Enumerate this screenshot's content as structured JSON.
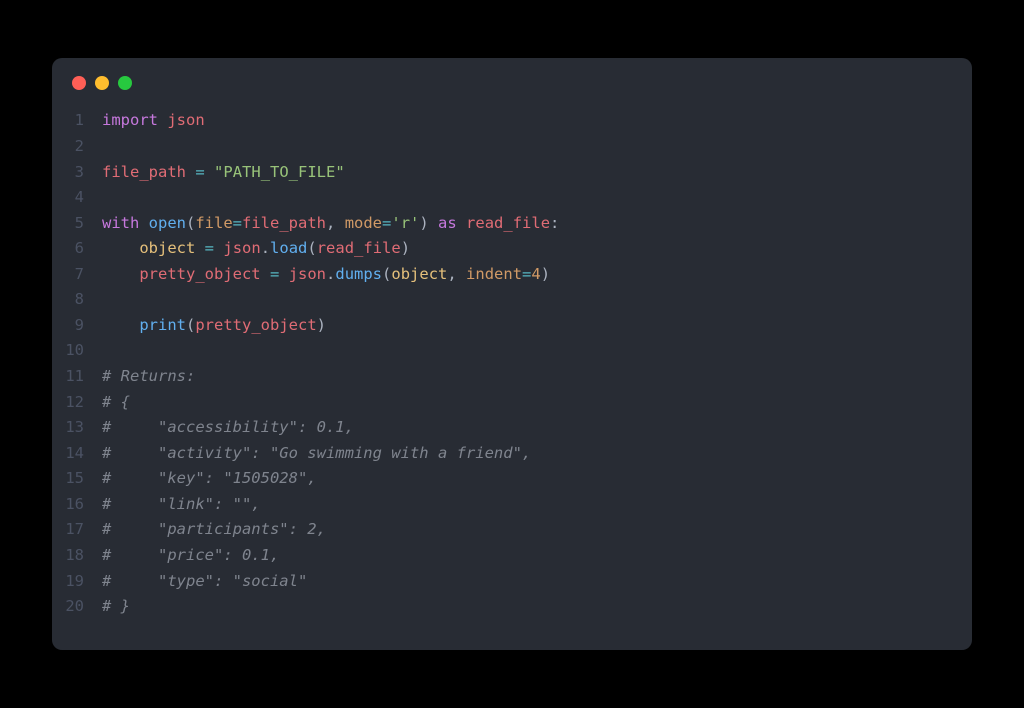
{
  "window": {
    "traffic_lights": [
      "close",
      "minimize",
      "zoom"
    ]
  },
  "editor": {
    "language": "python",
    "lines": [
      {
        "num": 1,
        "tokens": [
          {
            "t": "kw",
            "s": "import"
          },
          {
            "t": "pn",
            "s": " "
          },
          {
            "t": "var",
            "s": "json"
          }
        ]
      },
      {
        "num": 2,
        "tokens": []
      },
      {
        "num": 3,
        "tokens": [
          {
            "t": "var",
            "s": "file_path"
          },
          {
            "t": "pn",
            "s": " "
          },
          {
            "t": "op",
            "s": "="
          },
          {
            "t": "pn",
            "s": " "
          },
          {
            "t": "str",
            "s": "\"PATH_TO_FILE\""
          }
        ]
      },
      {
        "num": 4,
        "tokens": []
      },
      {
        "num": 5,
        "tokens": [
          {
            "t": "kw",
            "s": "with"
          },
          {
            "t": "pn",
            "s": " "
          },
          {
            "t": "fn",
            "s": "open"
          },
          {
            "t": "pn",
            "s": "("
          },
          {
            "t": "param",
            "s": "file"
          },
          {
            "t": "op",
            "s": "="
          },
          {
            "t": "var",
            "s": "file_path"
          },
          {
            "t": "pn",
            "s": ", "
          },
          {
            "t": "param",
            "s": "mode"
          },
          {
            "t": "op",
            "s": "="
          },
          {
            "t": "str",
            "s": "'r'"
          },
          {
            "t": "pn",
            "s": ") "
          },
          {
            "t": "kw",
            "s": "as"
          },
          {
            "t": "pn",
            "s": " "
          },
          {
            "t": "var",
            "s": "read_file"
          },
          {
            "t": "pn",
            "s": ":"
          }
        ]
      },
      {
        "num": 6,
        "tokens": [
          {
            "t": "pn",
            "s": "    "
          },
          {
            "t": "ident",
            "s": "object"
          },
          {
            "t": "pn",
            "s": " "
          },
          {
            "t": "op",
            "s": "="
          },
          {
            "t": "pn",
            "s": " "
          },
          {
            "t": "var",
            "s": "json"
          },
          {
            "t": "pn",
            "s": "."
          },
          {
            "t": "fn",
            "s": "load"
          },
          {
            "t": "pn",
            "s": "("
          },
          {
            "t": "var",
            "s": "read_file"
          },
          {
            "t": "pn",
            "s": ")"
          }
        ]
      },
      {
        "num": 7,
        "tokens": [
          {
            "t": "pn",
            "s": "    "
          },
          {
            "t": "var",
            "s": "pretty_object"
          },
          {
            "t": "pn",
            "s": " "
          },
          {
            "t": "op",
            "s": "="
          },
          {
            "t": "pn",
            "s": " "
          },
          {
            "t": "var",
            "s": "json"
          },
          {
            "t": "pn",
            "s": "."
          },
          {
            "t": "fn",
            "s": "dumps"
          },
          {
            "t": "pn",
            "s": "("
          },
          {
            "t": "ident",
            "s": "object"
          },
          {
            "t": "pn",
            "s": ", "
          },
          {
            "t": "param",
            "s": "indent"
          },
          {
            "t": "op",
            "s": "="
          },
          {
            "t": "num",
            "s": "4"
          },
          {
            "t": "pn",
            "s": ")"
          }
        ]
      },
      {
        "num": 8,
        "tokens": []
      },
      {
        "num": 9,
        "tokens": [
          {
            "t": "pn",
            "s": "    "
          },
          {
            "t": "fn",
            "s": "print"
          },
          {
            "t": "pn",
            "s": "("
          },
          {
            "t": "var",
            "s": "pretty_object"
          },
          {
            "t": "pn",
            "s": ")"
          }
        ]
      },
      {
        "num": 10,
        "tokens": []
      },
      {
        "num": 11,
        "tokens": [
          {
            "t": "cmt",
            "s": "# Returns:"
          }
        ]
      },
      {
        "num": 12,
        "tokens": [
          {
            "t": "cmt",
            "s": "# {"
          }
        ]
      },
      {
        "num": 13,
        "tokens": [
          {
            "t": "cmt",
            "s": "#     \"accessibility\": 0.1,"
          }
        ]
      },
      {
        "num": 14,
        "tokens": [
          {
            "t": "cmt",
            "s": "#     \"activity\": \"Go swimming with a friend\","
          }
        ]
      },
      {
        "num": 15,
        "tokens": [
          {
            "t": "cmt",
            "s": "#     \"key\": \"1505028\","
          }
        ]
      },
      {
        "num": 16,
        "tokens": [
          {
            "t": "cmt",
            "s": "#     \"link\": \"\","
          }
        ]
      },
      {
        "num": 17,
        "tokens": [
          {
            "t": "cmt",
            "s": "#     \"participants\": 2,"
          }
        ]
      },
      {
        "num": 18,
        "tokens": [
          {
            "t": "cmt",
            "s": "#     \"price\": 0.1,"
          }
        ]
      },
      {
        "num": 19,
        "tokens": [
          {
            "t": "cmt",
            "s": "#     \"type\": \"social\""
          }
        ]
      },
      {
        "num": 20,
        "tokens": [
          {
            "t": "cmt",
            "s": "# }"
          }
        ]
      }
    ]
  }
}
